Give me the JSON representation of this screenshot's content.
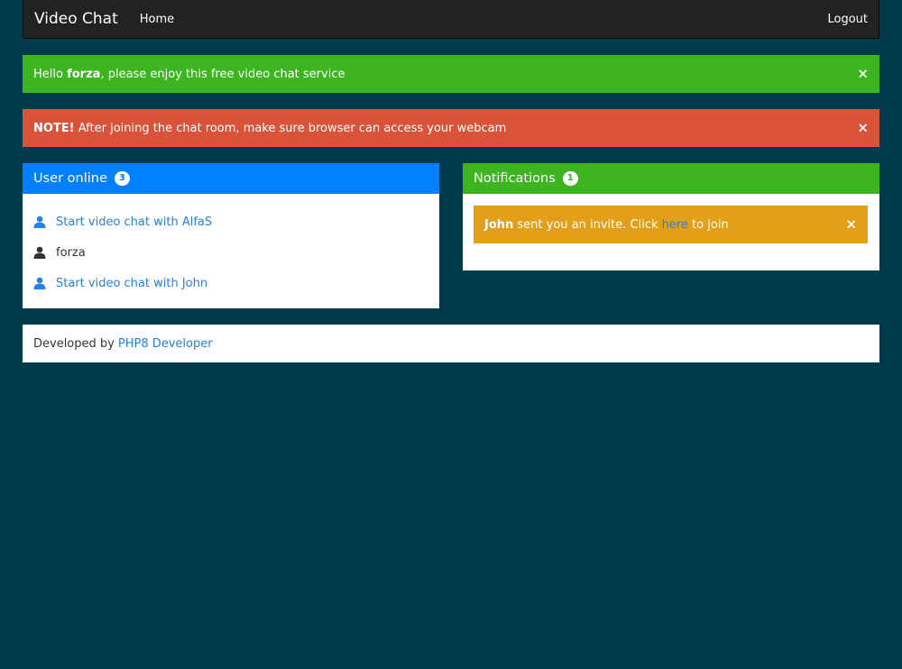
{
  "navbar": {
    "brand": "Video Chat",
    "home": "Home",
    "logout": "Logout"
  },
  "welcome_alert": {
    "prefix": "Hello ",
    "username": "forza",
    "suffix": ", please enjoy this free video chat service",
    "close": "×",
    "color": "#3cb521"
  },
  "note_alert": {
    "strong": "NOTE!",
    "text": " After joining the chat room, make sure browser can access your webcam",
    "close": "×",
    "color": "#d9533a"
  },
  "users_panel": {
    "title": "User online",
    "count": "3",
    "color": "#007fff",
    "users": [
      {
        "label": "Start video chat with AlfaS",
        "link": true,
        "icon": "user-icon"
      },
      {
        "label": "forza",
        "link": false,
        "icon": "user-icon"
      },
      {
        "label": "Start video chat with John",
        "link": true,
        "icon": "user-icon"
      }
    ]
  },
  "notifications_panel": {
    "title": "Notifications",
    "count": "1",
    "color": "#3cb521",
    "notification": {
      "sender": "John",
      "text_before": " sent you an invite. Click ",
      "link": "here",
      "text_after": " to join",
      "close": "×",
      "color": "#e49f1a"
    }
  },
  "footer": {
    "text": "Developed by",
    "link": "PHP8 Developer"
  }
}
